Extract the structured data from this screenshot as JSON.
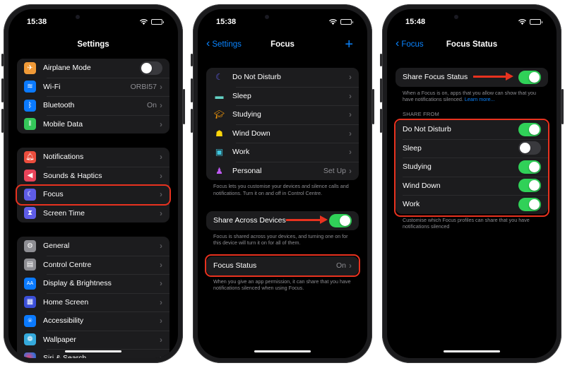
{
  "colors": {
    "accent": "#0a84ff",
    "toggle_on": "#30d158",
    "highlight": "#e8321f",
    "cell_background": "#1c1c1e",
    "secondary_text": "#8e8e93"
  },
  "screens": [
    {
      "status_time": "15:38",
      "nav": {
        "title": "Settings"
      },
      "groups": [
        {
          "items": [
            {
              "label": "Airplane Mode",
              "icon": "airplane-icon",
              "icon_color": "#f09a37",
              "control": "toggle",
              "toggle_on": false
            },
            {
              "label": "Wi-Fi",
              "icon": "wifi-icon",
              "icon_color": "#0a7aff",
              "value": "ORBI57",
              "control": "chevron"
            },
            {
              "label": "Bluetooth",
              "icon": "bluetooth-icon",
              "icon_color": "#0a7aff",
              "value": "On",
              "control": "chevron"
            },
            {
              "label": "Mobile Data",
              "icon": "antenna-icon",
              "icon_color": "#34c759",
              "control": "chevron"
            }
          ]
        },
        {
          "items": [
            {
              "label": "Notifications",
              "icon": "bell-icon",
              "icon_color": "#eb4d3d",
              "control": "chevron"
            },
            {
              "label": "Sounds & Haptics",
              "icon": "speaker-icon",
              "icon_color": "#e9445a",
              "control": "chevron"
            },
            {
              "label": "Focus",
              "icon": "moon-icon",
              "icon_color": "#5e5ce6",
              "control": "chevron",
              "highlighted": true
            },
            {
              "label": "Screen Time",
              "icon": "hourglass-icon",
              "icon_color": "#5e5ce6",
              "control": "chevron"
            }
          ]
        },
        {
          "items": [
            {
              "label": "General",
              "icon": "gear-icon",
              "icon_color": "#8e8e93",
              "control": "chevron"
            },
            {
              "label": "Control Centre",
              "icon": "switches-icon",
              "icon_color": "#8e8e93",
              "control": "chevron"
            },
            {
              "label": "Display & Brightness",
              "icon": "text-size-icon",
              "icon_color": "#0a7aff",
              "control": "chevron"
            },
            {
              "label": "Home Screen",
              "icon": "app-grid-icon",
              "icon_color": "#3b4fd8",
              "control": "chevron"
            },
            {
              "label": "Accessibility",
              "icon": "accessibility-icon",
              "icon_color": "#0a7aff",
              "control": "chevron"
            },
            {
              "label": "Wallpaper",
              "icon": "flower-icon",
              "icon_color": "#35aadc",
              "control": "chevron"
            },
            {
              "label": "Siri & Search",
              "icon": "siri-icon",
              "icon_color": "#2a2a2e",
              "control": "chevron"
            }
          ]
        }
      ]
    },
    {
      "status_time": "15:38",
      "nav": {
        "back_label": "Settings",
        "title": "Focus",
        "action": "+"
      },
      "focus_modes": [
        {
          "label": "Do Not Disturb",
          "icon": "moon-icon",
          "icon_color": "#5e5ce6"
        },
        {
          "label": "Sleep",
          "icon": "bed-icon",
          "icon_color": "#64d2c4"
        },
        {
          "label": "Studying",
          "icon": "graduation-cap-icon",
          "icon_color": "#ff9f0a"
        },
        {
          "label": "Wind Down",
          "icon": "wind-down-icon",
          "icon_color": "#ffd60a"
        },
        {
          "label": "Work",
          "icon": "work-badge-icon",
          "icon_color": "#40c8e0"
        },
        {
          "label": "Personal",
          "icon": "person-icon",
          "icon_color": "#bf5af2",
          "value": "Set Up"
        }
      ],
      "modes_footnote": "Focus lets you customise your devices and silence calls and notifications. Turn it on and off in Control Centre.",
      "share_across_devices": {
        "label": "Share Across Devices",
        "toggle_on": true
      },
      "share_footnote": "Focus is shared across your devices, and turning one on for this device will turn it on for all of them.",
      "focus_status": {
        "label": "Focus Status",
        "value": "On",
        "highlighted": true
      },
      "status_footnote": "When you give an app permission, it can share that you have notifications silenced when using Focus."
    },
    {
      "status_time": "15:48",
      "nav": {
        "back_label": "Focus",
        "title": "Focus Status"
      },
      "share_focus_status": {
        "label": "Share Focus Status",
        "toggle_on": true
      },
      "share_footnote": "When a Focus is on, apps that you allow can show that you have notifications silenced.",
      "learn_more": "Learn more...",
      "section_header": "SHARE FROM",
      "share_from": [
        {
          "label": "Do Not Disturb",
          "toggle_on": true
        },
        {
          "label": "Sleep",
          "toggle_on": false
        },
        {
          "label": "Studying",
          "toggle_on": true
        },
        {
          "label": "Wind Down",
          "toggle_on": true
        },
        {
          "label": "Work",
          "toggle_on": true
        }
      ],
      "share_from_footnote": "Customise which Focus profiles can share that you have notifications silenced"
    }
  ]
}
